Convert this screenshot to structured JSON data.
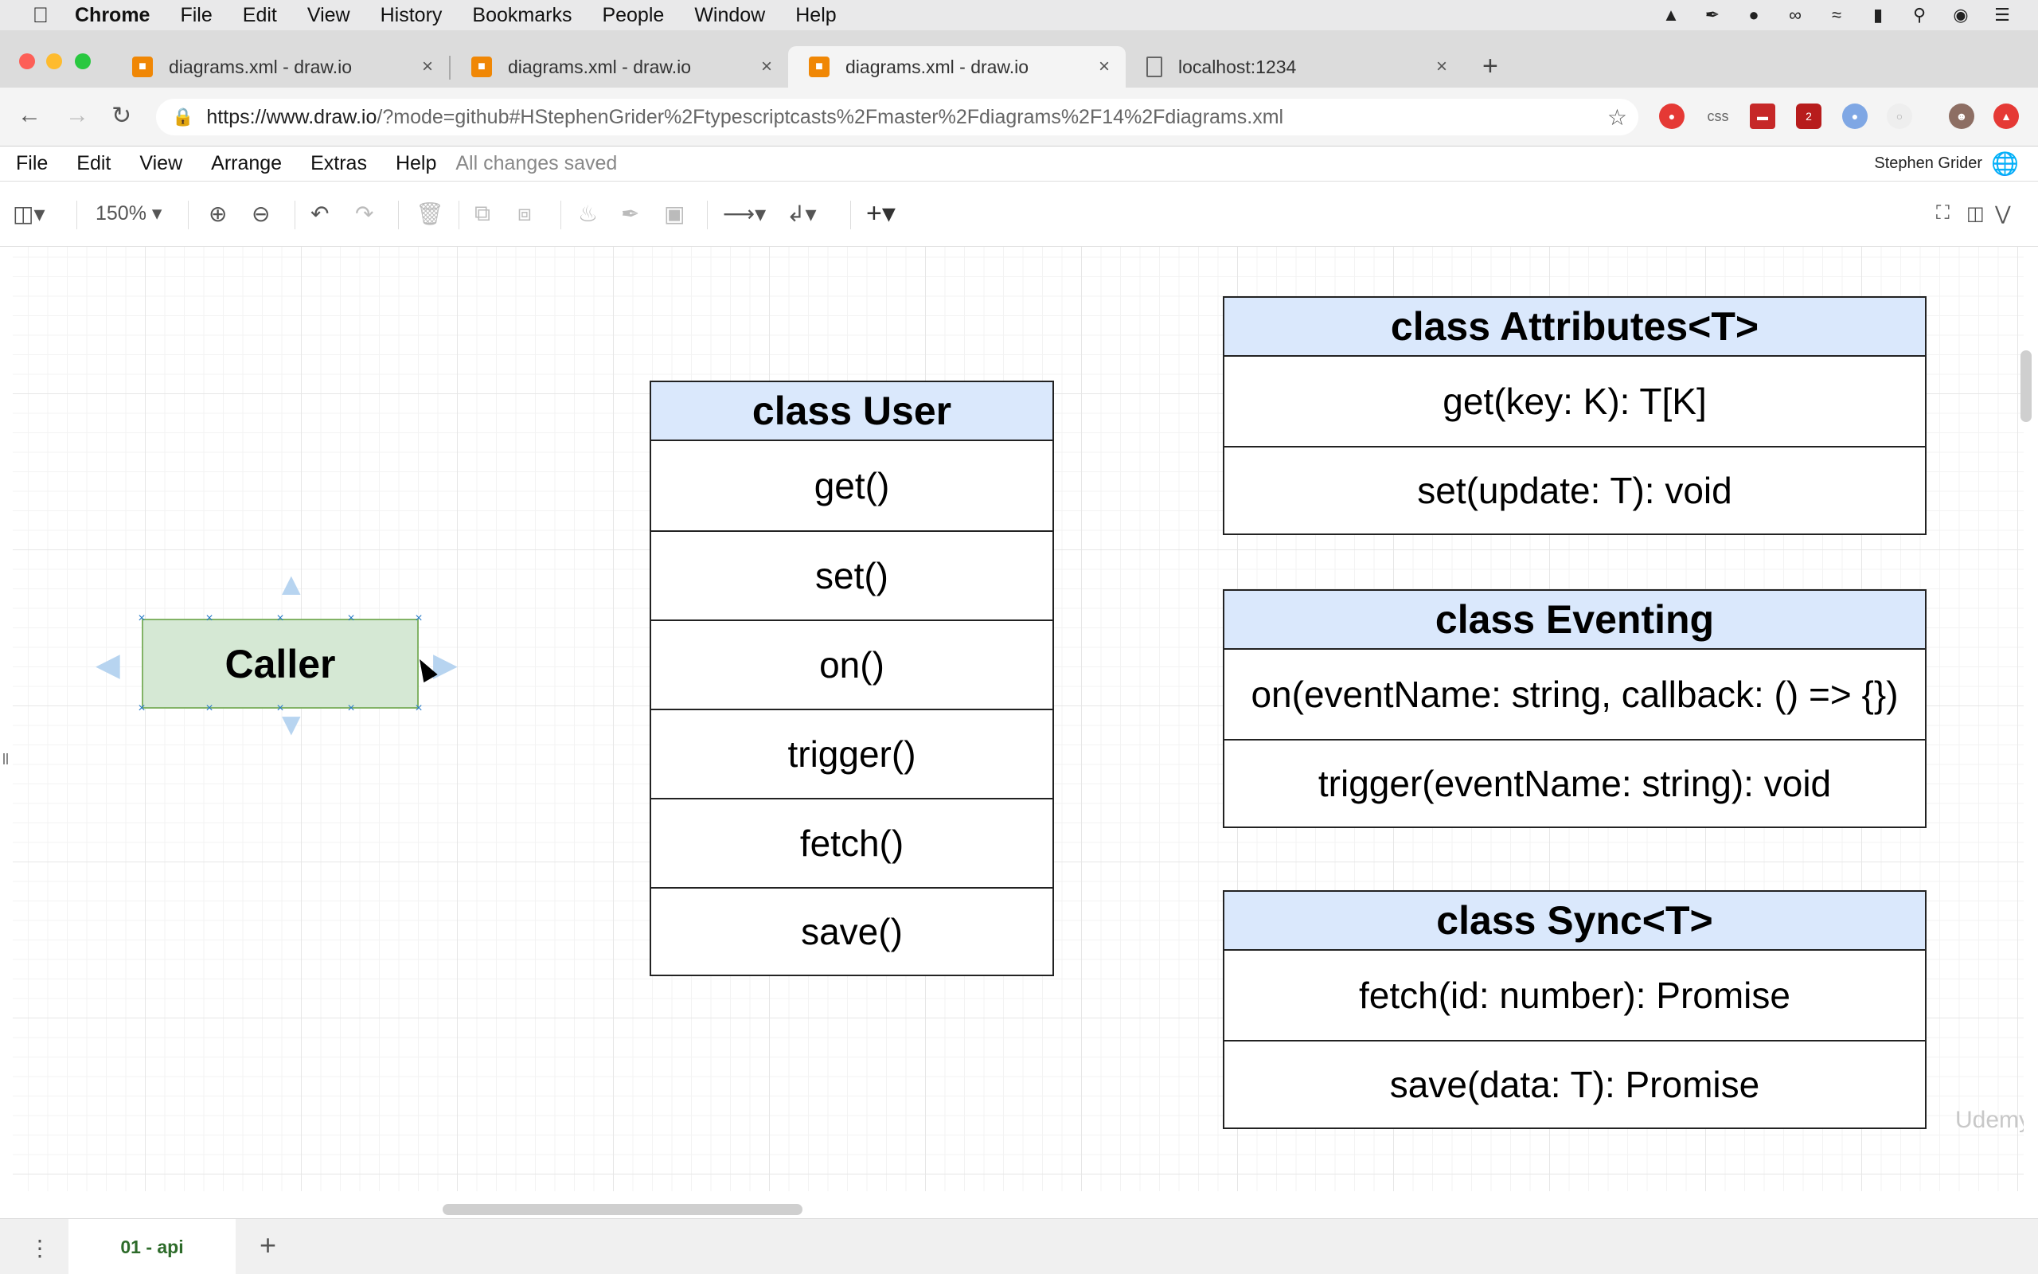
{
  "os_menubar": {
    "app_name": "Chrome",
    "items": [
      "File",
      "Edit",
      "View",
      "History",
      "Bookmarks",
      "People",
      "Window",
      "Help"
    ]
  },
  "browser": {
    "tabs": [
      {
        "title": "diagrams.xml - draw.io",
        "active": false
      },
      {
        "title": "diagrams.xml - draw.io",
        "active": false
      },
      {
        "title": "diagrams.xml - draw.io",
        "active": true
      },
      {
        "title": "localhost:1234",
        "active": false
      }
    ],
    "url": "https://www.draw.io/?mode=github#HStephenGrider%2Ftypescriptcasts%2Fmaster%2Fdiagrams%2F14%2Fdiagrams.xml",
    "url_host": "https://www.draw.io",
    "url_rest": "/?mode=github#HStephenGrider%2Ftypescriptcasts%2Fmaster%2Fdiagrams%2F14%2Fdiagrams.xml",
    "extension_badge": "2"
  },
  "app_menu": {
    "items": [
      "File",
      "Edit",
      "View",
      "Arrange",
      "Extras",
      "Help"
    ],
    "status": "All changes saved",
    "user": "Stephen Grider"
  },
  "toolbar": {
    "zoom": "150%"
  },
  "diagram": {
    "caller": {
      "label": "Caller"
    },
    "user_class": {
      "title": "class User",
      "methods": [
        "get()",
        "set()",
        "on()",
        "trigger()",
        "fetch()",
        "save()"
      ]
    },
    "attributes_class": {
      "title": "class Attributes<T>",
      "methods": [
        "get(key: K): T[K]",
        "set(update: T): void"
      ]
    },
    "eventing_class": {
      "title": "class Eventing",
      "methods": [
        "on(eventName: string, callback: () => {})",
        "trigger(eventName: string): void"
      ]
    },
    "sync_class": {
      "title": "class Sync<T>",
      "methods": [
        "fetch(id: number): Promise",
        "save(data: T): Promise"
      ]
    }
  },
  "pages": {
    "current": "01 - api"
  },
  "watermark": "Udemy"
}
